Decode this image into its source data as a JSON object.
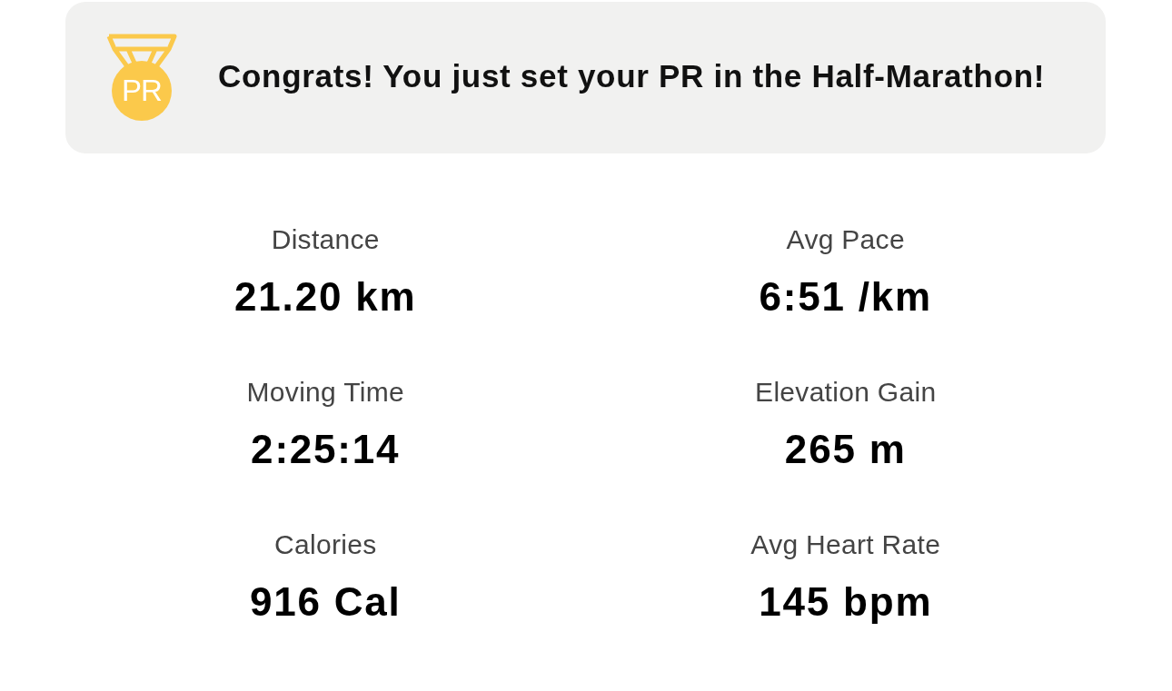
{
  "banner": {
    "medal_label": "PR",
    "message": "Congrats! You just set your PR in the Half-Marathon!"
  },
  "stats": [
    {
      "label": "Distance",
      "value": "21.20 km"
    },
    {
      "label": "Avg Pace",
      "value": "6:51 /km"
    },
    {
      "label": "Moving Time",
      "value": "2:25:14"
    },
    {
      "label": "Elevation Gain",
      "value": "265 m"
    },
    {
      "label": "Calories",
      "value": "916 Cal"
    },
    {
      "label": "Avg Heart Rate",
      "value": "145 bpm"
    }
  ]
}
